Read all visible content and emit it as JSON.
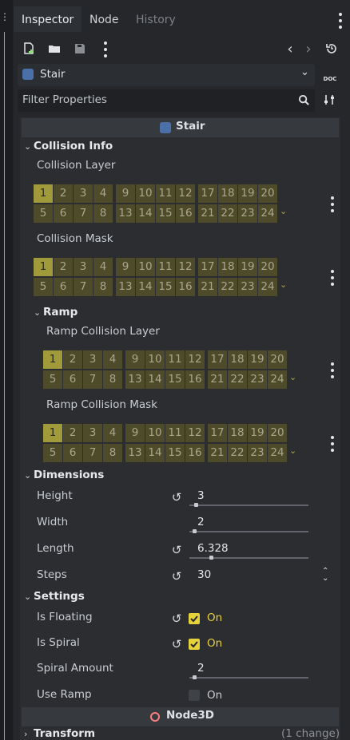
{
  "tabs": [
    {
      "label": "Inspector",
      "active": true
    },
    {
      "label": "Node",
      "active": false
    },
    {
      "label": "History",
      "active": false
    }
  ],
  "toolbar": {
    "icons": [
      "new-resource-icon",
      "open-folder-icon",
      "save-icon",
      "more-icon",
      "back-icon",
      "forward-icon",
      "history-icon"
    ]
  },
  "object_select": {
    "value": "Stair",
    "icon": "script-gear-icon",
    "doc_label": "DOC"
  },
  "filter": {
    "placeholder": "Filter Properties"
  },
  "inspector_title": "Stair",
  "sections": {
    "collision_info": "Collision Info",
    "ramp": "Ramp",
    "dimensions": "Dimensions",
    "settings": "Settings"
  },
  "layers": {
    "collision_layer": {
      "label": "Collision Layer",
      "enabled": [
        1
      ]
    },
    "collision_mask": {
      "label": "Collision Mask",
      "enabled": [
        1
      ]
    },
    "ramp_collision_layer": {
      "label": "Ramp Collision Layer",
      "enabled": [
        1
      ]
    },
    "ramp_collision_mask": {
      "label": "Ramp Collision Mask",
      "enabled": [
        1
      ]
    }
  },
  "dimensions": {
    "height": {
      "label": "Height",
      "value": "3",
      "revertible": true,
      "slider": 0.04
    },
    "width": {
      "label": "Width",
      "value": "2",
      "revertible": false,
      "slider": 0.03
    },
    "length": {
      "label": "Length",
      "value": "6.328",
      "revertible": true,
      "slider": 0.17
    },
    "steps": {
      "label": "Steps",
      "value": "30",
      "revertible": true
    }
  },
  "settings": {
    "is_floating": {
      "label": "Is Floating",
      "checked": true,
      "text": "On"
    },
    "is_spiral": {
      "label": "Is Spiral",
      "checked": true,
      "text": "On"
    },
    "spiral_amount": {
      "label": "Spiral Amount",
      "value": "2",
      "slider": 0.03
    },
    "use_ramp": {
      "label": "Use Ramp",
      "checked": false,
      "text": "On"
    }
  },
  "node3d_title": "Node3D",
  "transform": {
    "label": "Transform",
    "changes": "(1 change)"
  },
  "colors": {
    "accent_check": "#e6d33c",
    "layer_on": "#a19a3a",
    "layer_off": "#4d4b29"
  }
}
